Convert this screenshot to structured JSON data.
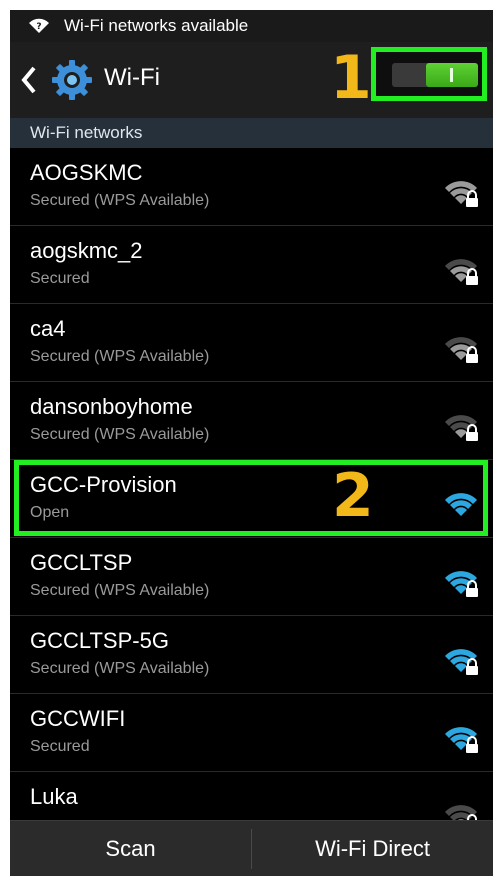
{
  "status_bar": {
    "notification_text": "Wi-Fi networks available",
    "icon": "wifi-notification-icon"
  },
  "action_bar": {
    "title": "Wi-Fi",
    "back_icon": "chevron-left-icon",
    "app_icon": "gear-icon",
    "toggle_on": true
  },
  "annotations": {
    "step1": "1",
    "step2": "2",
    "highlight_color": "#22ee22",
    "number_color": "#f2b81a"
  },
  "section_header": "Wi-Fi networks",
  "networks": [
    {
      "name": "AOGSKMC",
      "status": "Secured (WPS Available)",
      "icon": "wifi-lock-icon",
      "signal": 3,
      "color": "#9a9a9a"
    },
    {
      "name": "aogskmc_2",
      "status": "Secured",
      "icon": "wifi-lock-icon",
      "signal": 2,
      "color": "#9a9a9a"
    },
    {
      "name": "ca4",
      "status": "Secured (WPS Available)",
      "icon": "wifi-lock-icon",
      "signal": 2,
      "color": "#9a9a9a"
    },
    {
      "name": "dansonboyhome",
      "status": "Secured (WPS Available)",
      "icon": "wifi-lock-icon",
      "signal": 1,
      "color": "#9a9a9a"
    },
    {
      "name": "GCC-Provision",
      "status": "Open",
      "icon": "wifi-icon",
      "signal": 4,
      "color": "#2da7e0"
    },
    {
      "name": "GCCLTSP",
      "status": "Secured (WPS Available)",
      "icon": "wifi-lock-icon",
      "signal": 3,
      "color": "#2da7e0"
    },
    {
      "name": "GCCLTSP-5G",
      "status": "Secured (WPS Available)",
      "icon": "wifi-lock-icon",
      "signal": 3,
      "color": "#2da7e0"
    },
    {
      "name": "GCCWIFI",
      "status": "Secured",
      "icon": "wifi-lock-icon",
      "signal": 4,
      "color": "#2da7e0"
    },
    {
      "name": "Luka",
      "status": "",
      "icon": "wifi-lock-icon",
      "signal": 1,
      "color": "#9a9a9a"
    }
  ],
  "bottom_bar": {
    "scan_label": "Scan",
    "wifi_direct_label": "Wi-Fi Direct"
  }
}
